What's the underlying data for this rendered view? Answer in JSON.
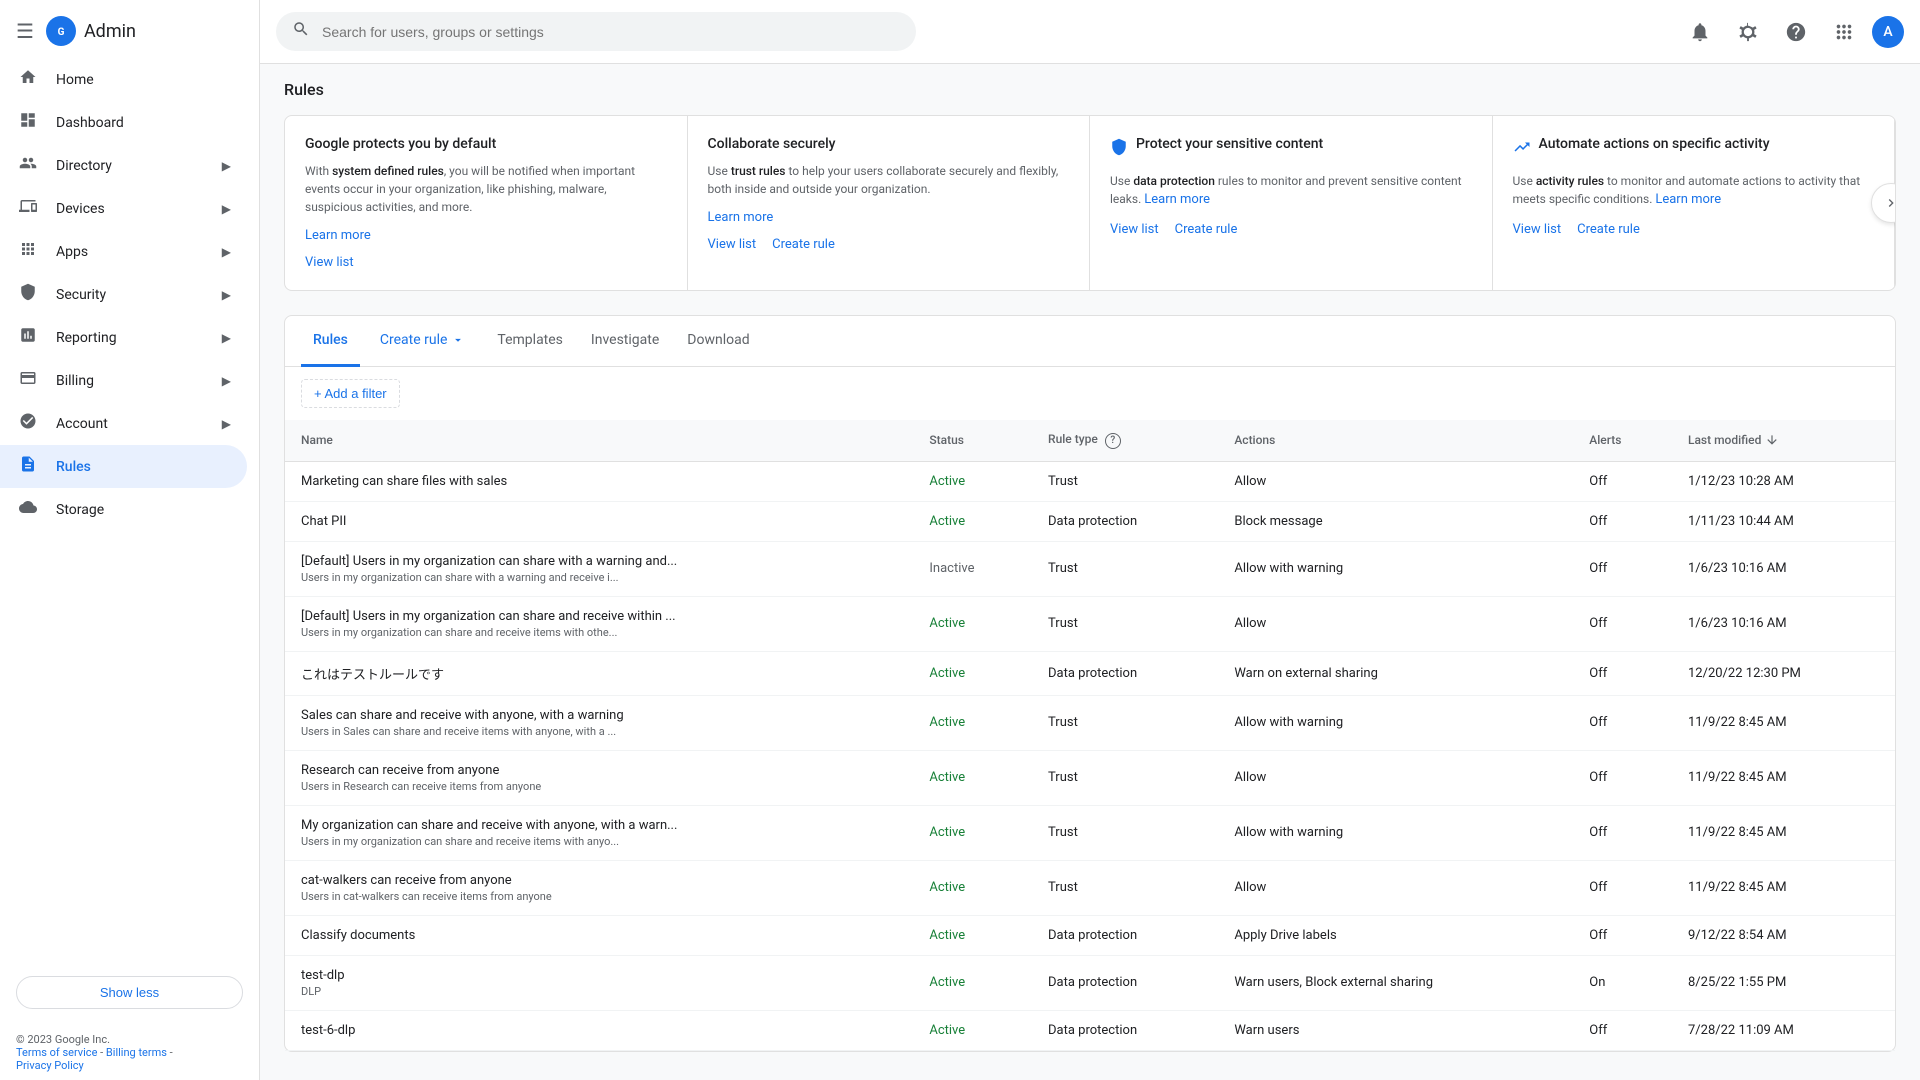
{
  "sidebar": {
    "app_name": "Admin",
    "nav_items": [
      {
        "id": "home",
        "label": "Home",
        "icon": "🏠",
        "active": false,
        "expandable": false
      },
      {
        "id": "dashboard",
        "label": "Dashboard",
        "icon": "📊",
        "active": false,
        "expandable": false
      },
      {
        "id": "directory",
        "label": "Directory",
        "icon": "👥",
        "active": false,
        "expandable": true
      },
      {
        "id": "devices",
        "label": "Devices",
        "icon": "💻",
        "active": false,
        "expandable": true
      },
      {
        "id": "apps",
        "label": "Apps",
        "icon": "⬛",
        "active": false,
        "expandable": true
      },
      {
        "id": "security",
        "label": "Security",
        "icon": "🔒",
        "active": false,
        "expandable": true
      },
      {
        "id": "reporting",
        "label": "Reporting",
        "icon": "📈",
        "active": false,
        "expandable": true
      },
      {
        "id": "billing",
        "label": "Billing",
        "icon": "💳",
        "active": false,
        "expandable": true
      },
      {
        "id": "account",
        "label": "Account",
        "icon": "⚙️",
        "active": false,
        "expandable": true
      },
      {
        "id": "rules",
        "label": "Rules",
        "icon": "📋",
        "active": true,
        "expandable": false
      },
      {
        "id": "storage",
        "label": "Storage",
        "icon": "☁️",
        "active": false,
        "expandable": false
      }
    ],
    "show_less_label": "Show less",
    "footer": {
      "copyright": "© 2023 Google Inc.",
      "terms_label": "Terms of service",
      "billing_label": "Billing terms",
      "privacy_label": "Privacy Policy"
    }
  },
  "topbar": {
    "search_placeholder": "Search for users, groups or settings",
    "avatar_letter": "A"
  },
  "page": {
    "title": "Rules"
  },
  "info_cards": [
    {
      "id": "system-defined",
      "title": "Google protects you by default",
      "body_prefix": "With ",
      "bold_text": "system defined rules",
      "body_suffix": ", you will be notified when important events occur in your organization, like phishing, malware, suspicious activities, and more.",
      "learn_more_label": "Learn more",
      "view_list_label": "View list",
      "icon": ""
    },
    {
      "id": "collaborate",
      "title": "Collaborate securely",
      "body_prefix": "Use ",
      "bold_text": "trust rules",
      "body_suffix": " to help your users collaborate securely and flexibly, both inside and outside your organization.",
      "learn_more_label": "Learn more",
      "view_list_label": "View list",
      "create_rule_label": "Create rule",
      "icon": ""
    },
    {
      "id": "sensitive",
      "title": "Protect your sensitive content",
      "body_prefix": "Use ",
      "bold_text": "data protection",
      "body_suffix": " rules to monitor and prevent sensitive content leaks.",
      "learn_more_label": "Learn more",
      "view_list_label": "View list",
      "create_rule_label": "Create rule",
      "icon": "🛡️"
    },
    {
      "id": "automate",
      "title": "Automate actions on specific activity",
      "body_prefix": "Use ",
      "bold_text": "activity rules",
      "body_suffix": " to monitor and automate actions to activity that meets specific conditions.",
      "learn_more_label": "Learn more",
      "view_list_label": "View list",
      "create_rule_label": "Create rule",
      "icon": "📈"
    }
  ],
  "rules_tabs": [
    {
      "id": "rules",
      "label": "Rules",
      "active": true
    },
    {
      "id": "create-rule",
      "label": "Create rule",
      "active": false,
      "dropdown": true
    },
    {
      "id": "templates",
      "label": "Templates",
      "active": false
    },
    {
      "id": "investigate",
      "label": "Investigate",
      "active": false
    },
    {
      "id": "download",
      "label": "Download",
      "active": false
    }
  ],
  "filter": {
    "add_filter_label": "+ Add a filter"
  },
  "table": {
    "columns": [
      {
        "id": "name",
        "label": "Name"
      },
      {
        "id": "status",
        "label": "Status"
      },
      {
        "id": "rule-type",
        "label": "Rule type",
        "has_help": true
      },
      {
        "id": "actions",
        "label": "Actions"
      },
      {
        "id": "alerts",
        "label": "Alerts"
      },
      {
        "id": "last-modified",
        "label": "Last modified",
        "sortable": true,
        "sort_dir": "desc"
      }
    ],
    "rows": [
      {
        "name": "Marketing can share files with sales",
        "subtitle": "",
        "status": "Active",
        "rule_type": "Trust",
        "actions": "Allow",
        "alerts": "Off",
        "last_modified": "1/12/23 10:28 AM"
      },
      {
        "name": "Chat PII",
        "subtitle": "",
        "status": "Active",
        "rule_type": "Data protection",
        "actions": "Block message",
        "alerts": "Off",
        "last_modified": "1/11/23 10:44 AM"
      },
      {
        "name": "[Default] Users in my organization can share with a warning and...",
        "subtitle": "Users in my organization can share with a warning and receive i...",
        "status": "Inactive",
        "rule_type": "Trust",
        "actions": "Allow with warning",
        "alerts": "Off",
        "last_modified": "1/6/23 10:16 AM"
      },
      {
        "name": "[Default] Users in my organization can share and receive within ...",
        "subtitle": "Users in my organization can share and receive items with othe...",
        "status": "Active",
        "rule_type": "Trust",
        "actions": "Allow",
        "alerts": "Off",
        "last_modified": "1/6/23 10:16 AM"
      },
      {
        "name": "これはテストルールです",
        "subtitle": "",
        "status": "Active",
        "rule_type": "Data protection",
        "actions": "Warn on external sharing",
        "alerts": "Off",
        "last_modified": "12/20/22 12:30 PM"
      },
      {
        "name": "Sales can share and receive with anyone, with a warning",
        "subtitle": "Users in Sales can share and receive items with anyone, with a ...",
        "status": "Active",
        "rule_type": "Trust",
        "actions": "Allow with warning",
        "alerts": "Off",
        "last_modified": "11/9/22 8:45 AM"
      },
      {
        "name": "Research can receive from anyone",
        "subtitle": "Users in Research can receive items from anyone",
        "status": "Active",
        "rule_type": "Trust",
        "actions": "Allow",
        "alerts": "Off",
        "last_modified": "11/9/22 8:45 AM"
      },
      {
        "name": "My organization can share and receive with anyone, with a warn...",
        "subtitle": "Users in my organization can share and receive items with anyo...",
        "status": "Active",
        "rule_type": "Trust",
        "actions": "Allow with warning",
        "alerts": "Off",
        "last_modified": "11/9/22 8:45 AM"
      },
      {
        "name": "cat-walkers can receive from anyone",
        "subtitle": "Users in cat-walkers can receive items from anyone",
        "status": "Active",
        "rule_type": "Trust",
        "actions": "Allow",
        "alerts": "Off",
        "last_modified": "11/9/22 8:45 AM"
      },
      {
        "name": "Classify documents",
        "subtitle": "",
        "status": "Active",
        "rule_type": "Data protection",
        "actions": "Apply Drive labels",
        "alerts": "Off",
        "last_modified": "9/12/22 8:54 AM"
      },
      {
        "name": "test-dlp",
        "subtitle": "DLP",
        "status": "Active",
        "rule_type": "Data protection",
        "actions": "Warn users, Block external sharing",
        "alerts": "On",
        "last_modified": "8/25/22 1:55 PM"
      },
      {
        "name": "test-6-dlp",
        "subtitle": "",
        "status": "Active",
        "rule_type": "Data protection",
        "actions": "Warn users",
        "alerts": "Off",
        "last_modified": "7/28/22 11:09 AM"
      }
    ]
  }
}
